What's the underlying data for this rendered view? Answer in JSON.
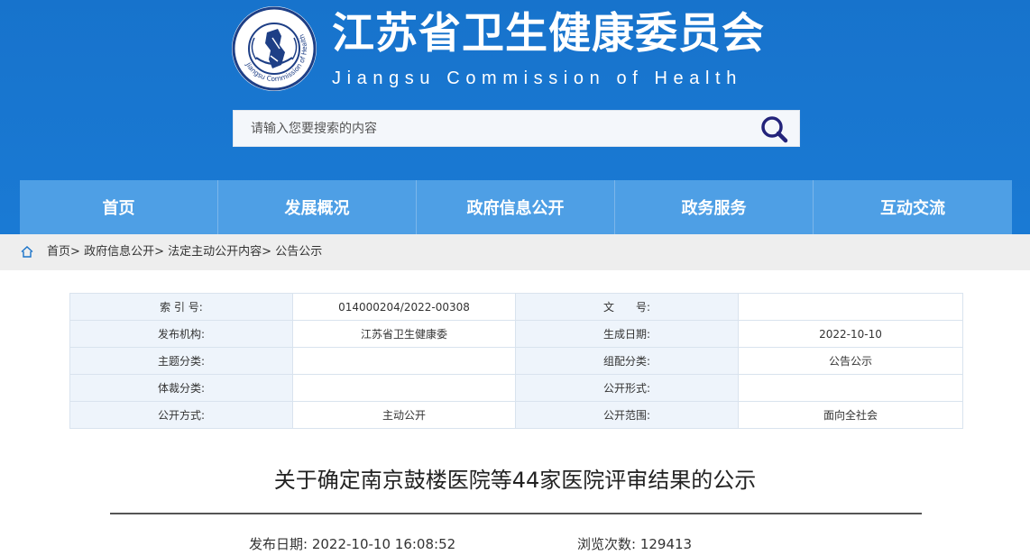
{
  "header": {
    "title_cn": "江苏省卫生健康委员会",
    "title_en": "Jiangsu Commission of Health",
    "emblem_text": "Jiangsu Commission of Health",
    "colors": {
      "header_bg": "#1773cc",
      "nav_bg": "#4e9fe5",
      "emblem_ring": "#1e3f86"
    }
  },
  "search": {
    "placeholder": "请输入您要搜索的内容",
    "value": "",
    "icon": "search-icon"
  },
  "nav": {
    "items": [
      "首页",
      "发展概况",
      "政府信息公开",
      "政务服务",
      "互动交流"
    ]
  },
  "breadcrumb": {
    "icon": "home-icon",
    "items": [
      "首页",
      "政府信息公开",
      "法定主动公开内容",
      "公告公示"
    ],
    "separator": ">"
  },
  "meta": {
    "rows": [
      [
        "索 引 号:",
        "014000204/2022-00308",
        "文　　号:",
        ""
      ],
      [
        "发布机构:",
        "江苏省卫生健康委",
        "生成日期:",
        "2022-10-10"
      ],
      [
        "主题分类:",
        "",
        "组配分类:",
        "公告公示"
      ],
      [
        "体裁分类:",
        "",
        "公开形式:",
        ""
      ],
      [
        "公开方式:",
        "主动公开",
        "公开范围:",
        "面向全社会"
      ]
    ]
  },
  "article": {
    "title": "关于确定南京鼓楼医院等44家医院评审结果的公示",
    "publish_label": "发布日期:",
    "publish_value": "2022-10-10 16:08:52",
    "views_label": "浏览次数:",
    "views_value": "129413"
  }
}
